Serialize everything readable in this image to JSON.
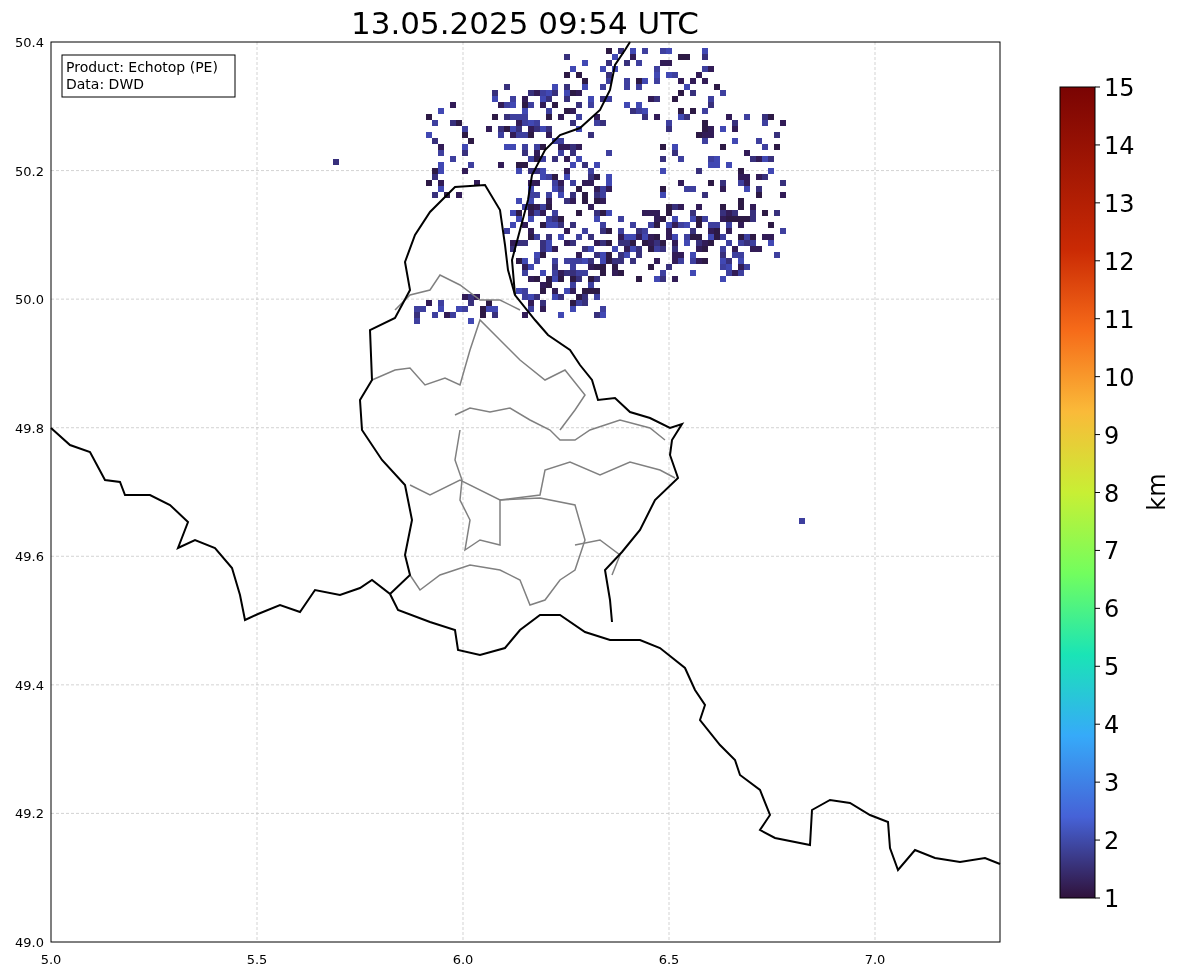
{
  "title": "13.05.2025 09:54 UTC",
  "info_box": [
    "Product: Echotop (PE)",
    "Data: DWD"
  ],
  "x_ticks": [
    "5.0",
    "5.5",
    "6.0",
    "6.5",
    "7.0"
  ],
  "y_ticks": [
    "50.4",
    "50.2",
    "50.0",
    "49.8",
    "49.6",
    "49.4",
    "49.2",
    "49.0"
  ],
  "colorbar": {
    "label": "km",
    "ticks": [
      "15",
      "14",
      "13",
      "12",
      "11",
      "10",
      "9",
      "8",
      "7",
      "6",
      "5",
      "4",
      "3",
      "2",
      "1"
    ]
  }
}
